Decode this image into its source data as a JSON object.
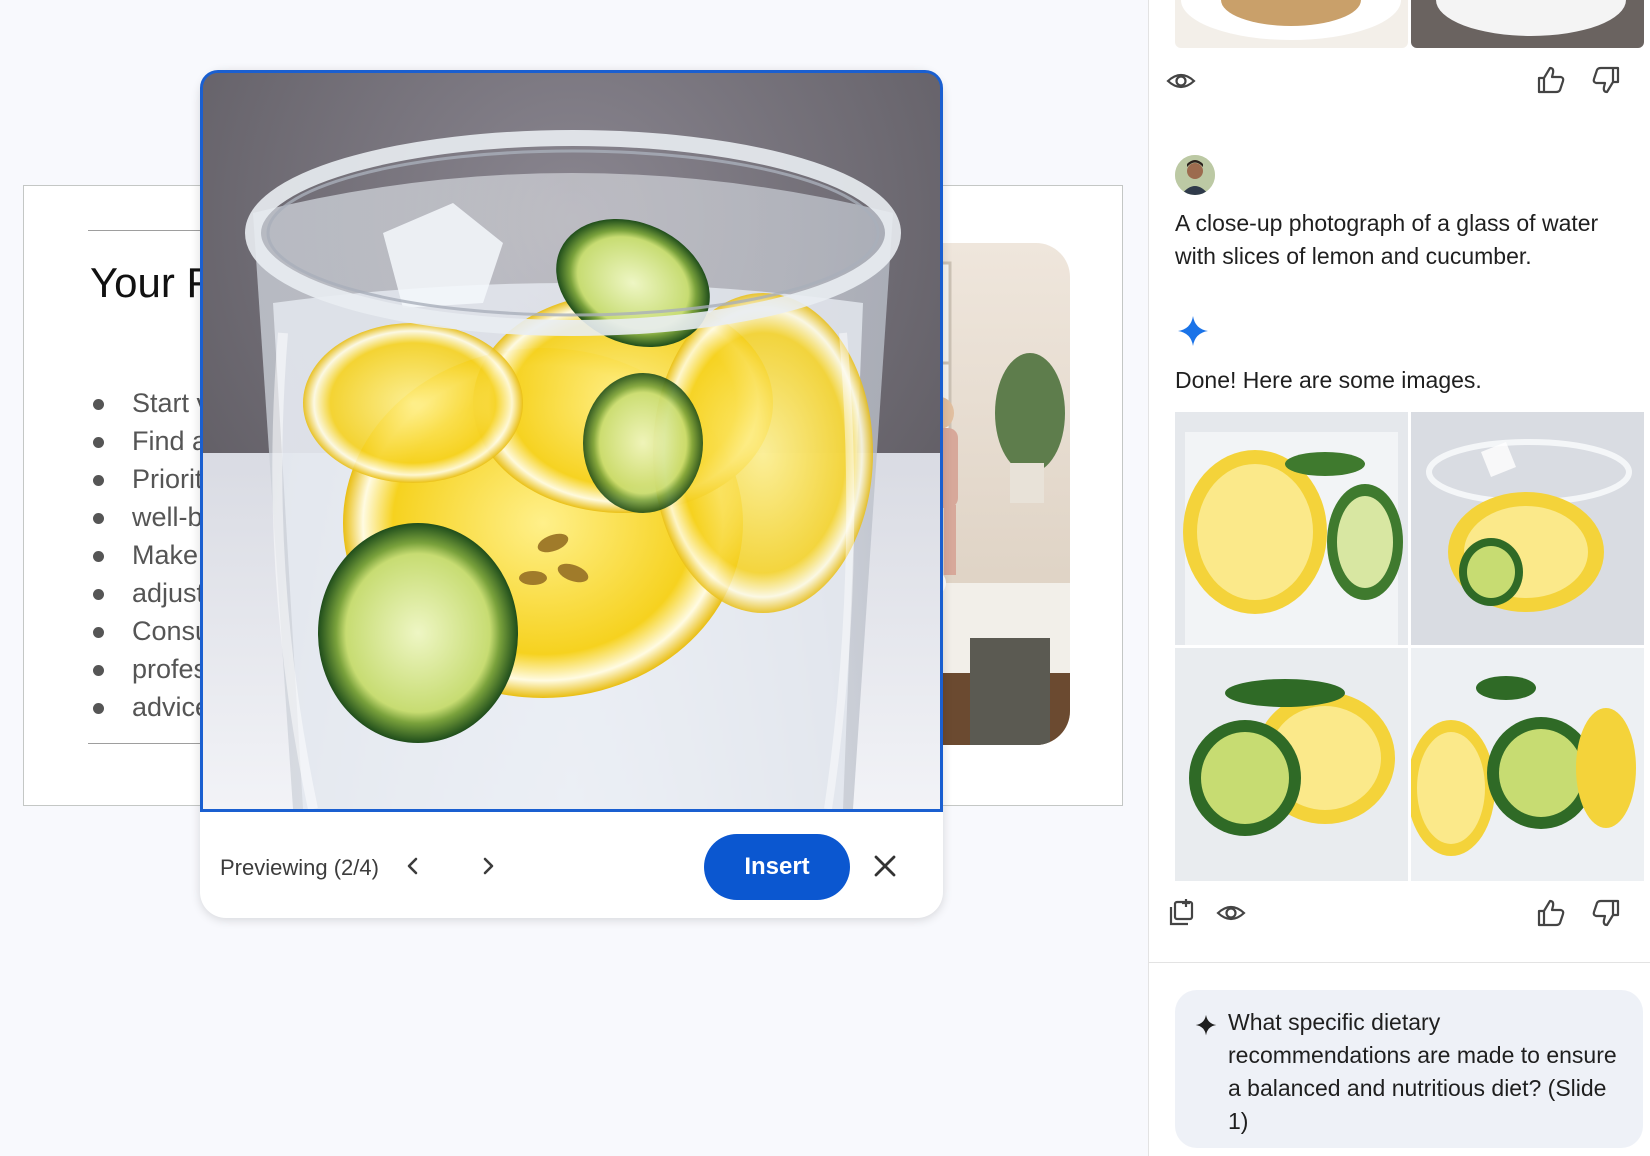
{
  "slide": {
    "title": "Your F",
    "bullets": [
      "Start v",
      "Find a",
      "Priorit",
      "well-b",
      "Make",
      "adjust",
      "Consu",
      "profes",
      "advice"
    ]
  },
  "preview": {
    "label": "Previewing (2/4)",
    "insert_label": "Insert",
    "image_icon": "lemon-cucumber-water-photo"
  },
  "panel": {
    "user_prompt": "A close-up photograph of a glass of water with slices of lemon and cucumber.",
    "response_text": "Done! Here are some images.",
    "suggestion": "What specific dietary recommendations are made to ensure a balanced and nutritious diet? (Slide 1)"
  },
  "colors": {
    "accent": "#0b57d0",
    "sparkle": "#1a73e8",
    "panel_bg": "#ffffff",
    "suggestion_bg": "#eef1f7"
  }
}
